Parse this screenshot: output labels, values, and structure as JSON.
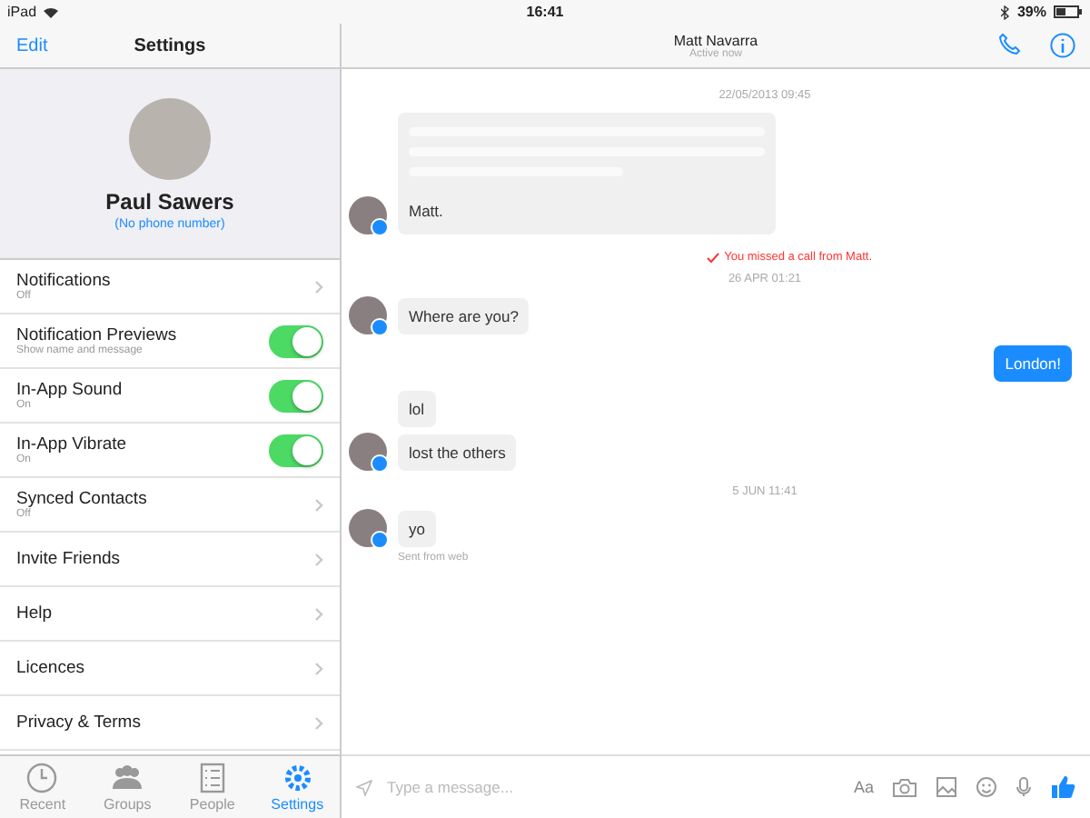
{
  "status_bar": {
    "device": "iPad",
    "time": "16:41",
    "battery": "39%"
  },
  "sidebar": {
    "edit": "Edit",
    "title": "Settings",
    "profile": {
      "name": "Paul Sawers",
      "phone": "(No phone number)"
    },
    "rows": [
      {
        "kind": "link",
        "label": "Notifications",
        "detail": "Off"
      },
      {
        "kind": "toggle",
        "label": "Notification Previews",
        "detail": "Show name and message",
        "on": true
      },
      {
        "kind": "toggle",
        "label": "In-App Sound",
        "detail": "On",
        "on": true
      },
      {
        "kind": "toggle",
        "label": "In-App Vibrate",
        "detail": "On",
        "on": true
      },
      {
        "kind": "link",
        "label": "Synced Contacts",
        "detail": "Off"
      },
      {
        "kind": "link",
        "label": "Invite Friends"
      },
      {
        "kind": "link",
        "label": "Help"
      },
      {
        "kind": "link",
        "label": "Licences"
      },
      {
        "kind": "link",
        "label": "Privacy & Terms"
      }
    ],
    "tabs": [
      {
        "label": "Recent",
        "selected": false
      },
      {
        "label": "Groups",
        "selected": false
      },
      {
        "label": "People",
        "selected": false
      },
      {
        "label": "Settings",
        "selected": true
      }
    ]
  },
  "chat": {
    "name": "Matt Navarra",
    "status": "Active now",
    "messages": [
      {
        "kind": "timestamp",
        "text": "22/05/2013 09:45"
      },
      {
        "kind": "incoming",
        "text": "Matt.",
        "avatar": true,
        "redacted": true
      },
      {
        "kind": "missed_call",
        "text": "You missed a call from Matt."
      },
      {
        "kind": "timestamp",
        "text": "26 APR 01:21"
      },
      {
        "kind": "incoming",
        "text": "Where are you?",
        "avatar": true
      },
      {
        "kind": "outgoing",
        "text": "London!"
      },
      {
        "kind": "incoming",
        "text": "lol",
        "avatar": false
      },
      {
        "kind": "incoming",
        "text": "lost the others",
        "avatar": true
      },
      {
        "kind": "timestamp",
        "text": "5 JUN 11:41"
      },
      {
        "kind": "incoming",
        "text": "yo",
        "avatar": true
      },
      {
        "kind": "note",
        "text": "Sent from web"
      }
    ],
    "composer": {
      "placeholder": "Type a message...",
      "font_button": "Aa"
    }
  }
}
